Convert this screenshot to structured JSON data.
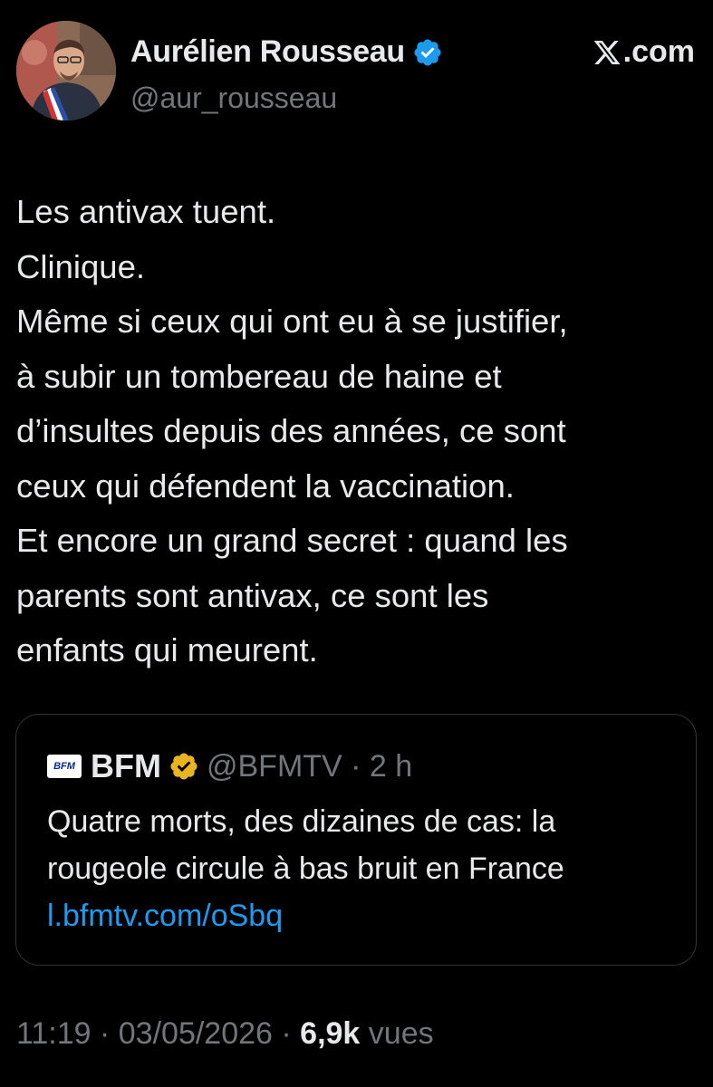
{
  "author": {
    "display_name": "Aurélien Rousseau",
    "handle": "@aur_rousseau",
    "verified_color": "#1d9bf0"
  },
  "source": {
    "label": ".com"
  },
  "tweet": {
    "lines": [
      "Les antivax tuent.",
      "Clinique.",
      "Même si ceux qui ont eu à se justifier,",
      "à subir un tombereau de haine et",
      "d’insultes depuis des années, ce sont",
      "ceux qui défendent la vaccination.",
      "Et encore un grand secret : quand les",
      "parents sont antivax, ce sont les",
      "enfants qui meurent."
    ]
  },
  "quote": {
    "logo_text": "BFM",
    "name": "BFM",
    "handle_time": "@BFMTV · 2 h",
    "verified_color": "#e8b521",
    "lines": [
      "Quatre morts, des dizaines de cas: la",
      "rougeole circule à bas bruit en France"
    ],
    "link": "l.bfmtv.com/oSbq",
    "link_color": "#1d9bf0"
  },
  "meta": {
    "time_date": "11:19 · 03/05/2026 · ",
    "views_count": "6,9k",
    "views_label": " vues"
  }
}
